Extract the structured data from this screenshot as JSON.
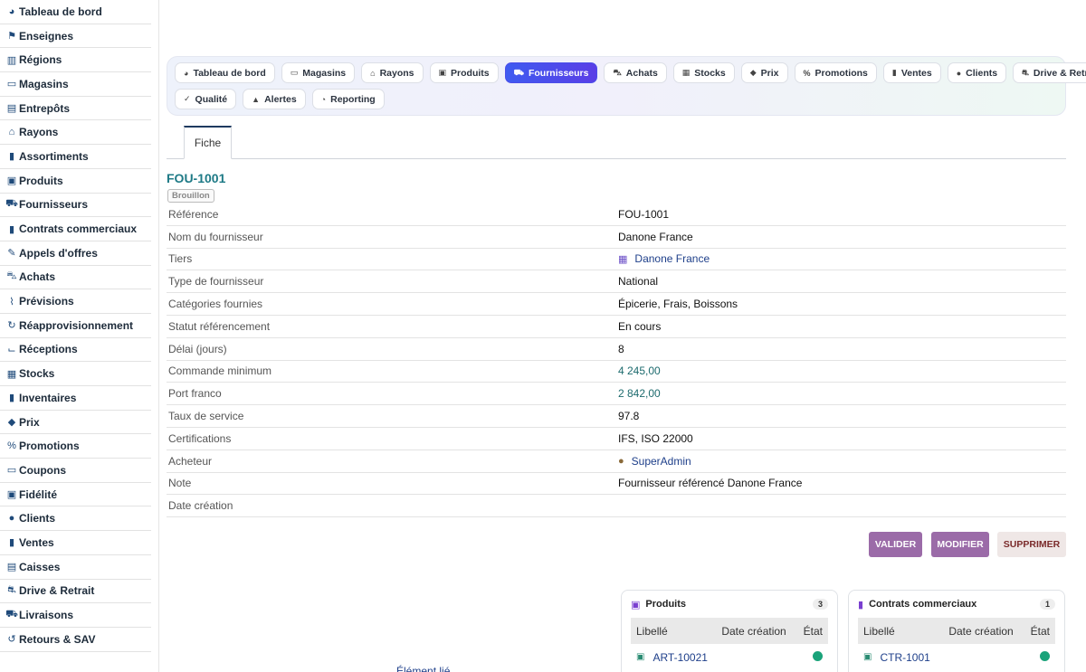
{
  "sidebar": {
    "items": [
      {
        "label": "Tableau de bord",
        "icon": "gauge-icon",
        "glyph": "◕"
      },
      {
        "label": "Enseignes",
        "icon": "flag-icon",
        "glyph": "⚑"
      },
      {
        "label": "Régions",
        "icon": "map-icon",
        "glyph": "▥"
      },
      {
        "label": "Magasins",
        "icon": "store-icon",
        "glyph": "▭"
      },
      {
        "label": "Entrepôts",
        "icon": "warehouse-icon",
        "glyph": "▤"
      },
      {
        "label": "Rayons",
        "icon": "basket-icon",
        "glyph": "⌂"
      },
      {
        "label": "Assortiments",
        "icon": "list-icon",
        "glyph": "▮"
      },
      {
        "label": "Produits",
        "icon": "box-icon",
        "glyph": "▣"
      },
      {
        "label": "Fournisseurs",
        "icon": "dolly-icon",
        "glyph": "⛟"
      },
      {
        "label": "Contrats commerciaux",
        "icon": "document-icon",
        "glyph": "▮"
      },
      {
        "label": "Appels d'offres",
        "icon": "gavel-icon",
        "glyph": "✎"
      },
      {
        "label": "Achats",
        "icon": "cart-icon",
        "glyph": "⛍"
      },
      {
        "label": "Prévisions",
        "icon": "chart-line-icon",
        "glyph": "⌇"
      },
      {
        "label": "Réapprovisionnement",
        "icon": "refresh-icon",
        "glyph": "↻"
      },
      {
        "label": "Réceptions",
        "icon": "dolly-flatbed-icon",
        "glyph": "⌙"
      },
      {
        "label": "Stocks",
        "icon": "cubes-icon",
        "glyph": "▦"
      },
      {
        "label": "Inventaires",
        "icon": "clipboard-icon",
        "glyph": "▮"
      },
      {
        "label": "Prix",
        "icon": "tag-icon",
        "glyph": "◆"
      },
      {
        "label": "Promotions",
        "icon": "percent-icon",
        "glyph": "%"
      },
      {
        "label": "Coupons",
        "icon": "ticket-icon",
        "glyph": "▭"
      },
      {
        "label": "Fidélité",
        "icon": "id-card-icon",
        "glyph": "▣"
      },
      {
        "label": "Clients",
        "icon": "user-icon",
        "glyph": "●"
      },
      {
        "label": "Ventes",
        "icon": "receipt-icon",
        "glyph": "▮"
      },
      {
        "label": "Caisses",
        "icon": "cash-register-icon",
        "glyph": "▤"
      },
      {
        "label": "Drive & Retrait",
        "icon": "car-icon",
        "glyph": "⛐"
      },
      {
        "label": "Livraisons",
        "icon": "truck-icon",
        "glyph": "⛟"
      },
      {
        "label": "Retours & SAV",
        "icon": "undo-icon",
        "glyph": "↺"
      }
    ]
  },
  "topmenu": {
    "row1": [
      {
        "label": "Tableau de bord",
        "icon": "gauge-icon",
        "glyph": "◕"
      },
      {
        "label": "Magasins",
        "icon": "store-icon",
        "glyph": "▭"
      },
      {
        "label": "Rayons",
        "icon": "basket-icon",
        "glyph": "⌂"
      },
      {
        "label": "Produits",
        "icon": "box-icon",
        "glyph": "▣"
      },
      {
        "label": "Fournisseurs",
        "icon": "dolly-icon",
        "glyph": "⛟",
        "active": true
      },
      {
        "label": "Achats",
        "icon": "cart-icon",
        "glyph": "⛍"
      },
      {
        "label": "Stocks",
        "icon": "cubes-icon",
        "glyph": "▦"
      },
      {
        "label": "Prix",
        "icon": "tag-icon",
        "glyph": "◆"
      },
      {
        "label": "Promotions",
        "icon": "percent-icon",
        "glyph": "%"
      },
      {
        "label": "Ventes",
        "icon": "receipt-icon",
        "glyph": "▮"
      },
      {
        "label": "Clients",
        "icon": "user-icon",
        "glyph": "●"
      },
      {
        "label": "Drive & Retrait",
        "icon": "car-icon",
        "glyph": "⛐"
      }
    ],
    "row2": [
      {
        "label": "Qualité",
        "icon": "check-double-icon",
        "glyph": "✓"
      },
      {
        "label": "Alertes",
        "icon": "bell-icon",
        "glyph": "▲"
      },
      {
        "label": "Reporting",
        "icon": "pie-chart-icon",
        "glyph": "◔"
      }
    ]
  },
  "tabs": {
    "fiche": "Fiche"
  },
  "record": {
    "title": "FOU-1001",
    "status": "Brouillon",
    "fields": [
      {
        "label": "Référence",
        "value": "FOU-1001"
      },
      {
        "label": "Nom du fournisseur",
        "value": "Danone France"
      },
      {
        "label": "Tiers",
        "value": "Danone France",
        "type": "link",
        "icon": "building-icon",
        "glyph": "▦",
        "icon_color": "#6b4fc7"
      },
      {
        "label": "Type de fournisseur",
        "value": "National"
      },
      {
        "label": "Catégories fournies",
        "value": "Épicerie, Frais, Boissons"
      },
      {
        "label": "Statut référencement",
        "value": "En cours"
      },
      {
        "label": "Délai (jours)",
        "value": "8"
      },
      {
        "label": "Commande minimum",
        "value": "4 245,00",
        "type": "num"
      },
      {
        "label": "Port franco",
        "value": "2 842,00",
        "type": "num"
      },
      {
        "label": "Taux de service",
        "value": "97.8"
      },
      {
        "label": "Certifications",
        "value": "IFS, ISO 22000"
      },
      {
        "label": "Acheteur",
        "value": "SuperAdmin",
        "type": "link",
        "icon": "user-icon",
        "glyph": "●",
        "icon_color": "#8a6a3a"
      },
      {
        "label": "Note",
        "value": "Fournisseur référencé Danone France"
      },
      {
        "label": "Date création",
        "value": ""
      }
    ]
  },
  "actions": {
    "valider": "VALIDER",
    "modifier": "MODIFIER",
    "supprimer": "SUPPRIMER"
  },
  "cards": {
    "produits": {
      "title": "Produits",
      "count": "3",
      "headers": [
        "Libellé",
        "Date création",
        "État"
      ],
      "rows": [
        {
          "label": "ART-10021",
          "date": ""
        }
      ]
    },
    "contrats": {
      "title": "Contrats commerciaux",
      "count": "1",
      "headers": [
        "Libellé",
        "Date création",
        "État"
      ],
      "rows": [
        {
          "label": "CTR-1001",
          "date": ""
        }
      ]
    }
  },
  "colors": {
    "accent": "#4b4ee9",
    "title": "#1e7a86",
    "status_ok": "#1aa37a",
    "button": "#9b6ba8"
  },
  "footer": {
    "partial_text": "Élément lié"
  }
}
